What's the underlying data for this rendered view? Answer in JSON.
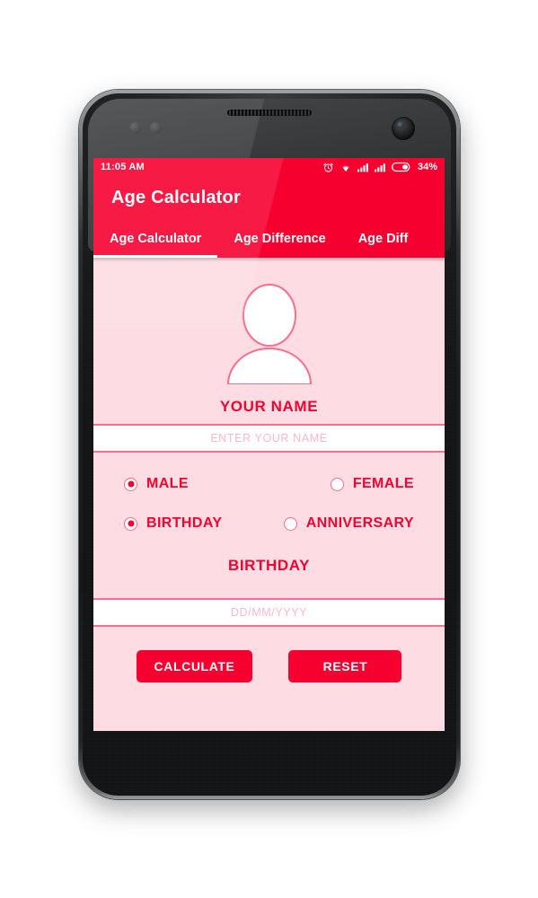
{
  "device": {
    "type": "android-phone-mockup"
  },
  "status_bar": {
    "time": "11:05 AM",
    "battery_percent": "34%",
    "icons": [
      "alarm-icon",
      "wifi-icon",
      "signal-icon-1",
      "signal-icon-2",
      "battery-icon"
    ]
  },
  "app": {
    "title": "Age Calculator",
    "accent_color": "#f5002f",
    "background_color": "#fddde3",
    "field_line_color": "#fb6d8c",
    "placeholder_color": "#fbb9c8"
  },
  "tabs": [
    {
      "label": "Age Calculator",
      "active": true
    },
    {
      "label": "Age Difference",
      "active": false
    },
    {
      "label": "Age Diff",
      "active": false
    }
  ],
  "form": {
    "avatar_icon": "person-avatar-icon",
    "name_label": "YOUR NAME",
    "name_value": "",
    "name_placeholder": "ENTER YOUR NAME",
    "gender_options": [
      {
        "label": "MALE",
        "selected": true
      },
      {
        "label": "FEMALE",
        "selected": false
      }
    ],
    "occasion_options": [
      {
        "label": "BIRTHDAY",
        "selected": true
      },
      {
        "label": "ANNIVERSARY",
        "selected": false
      }
    ],
    "date_section_label": "BIRTHDAY",
    "date_value": "",
    "date_placeholder": "DD/MM/YYYY"
  },
  "actions": {
    "calculate_label": "CALCULATE",
    "reset_label": "RESET"
  }
}
